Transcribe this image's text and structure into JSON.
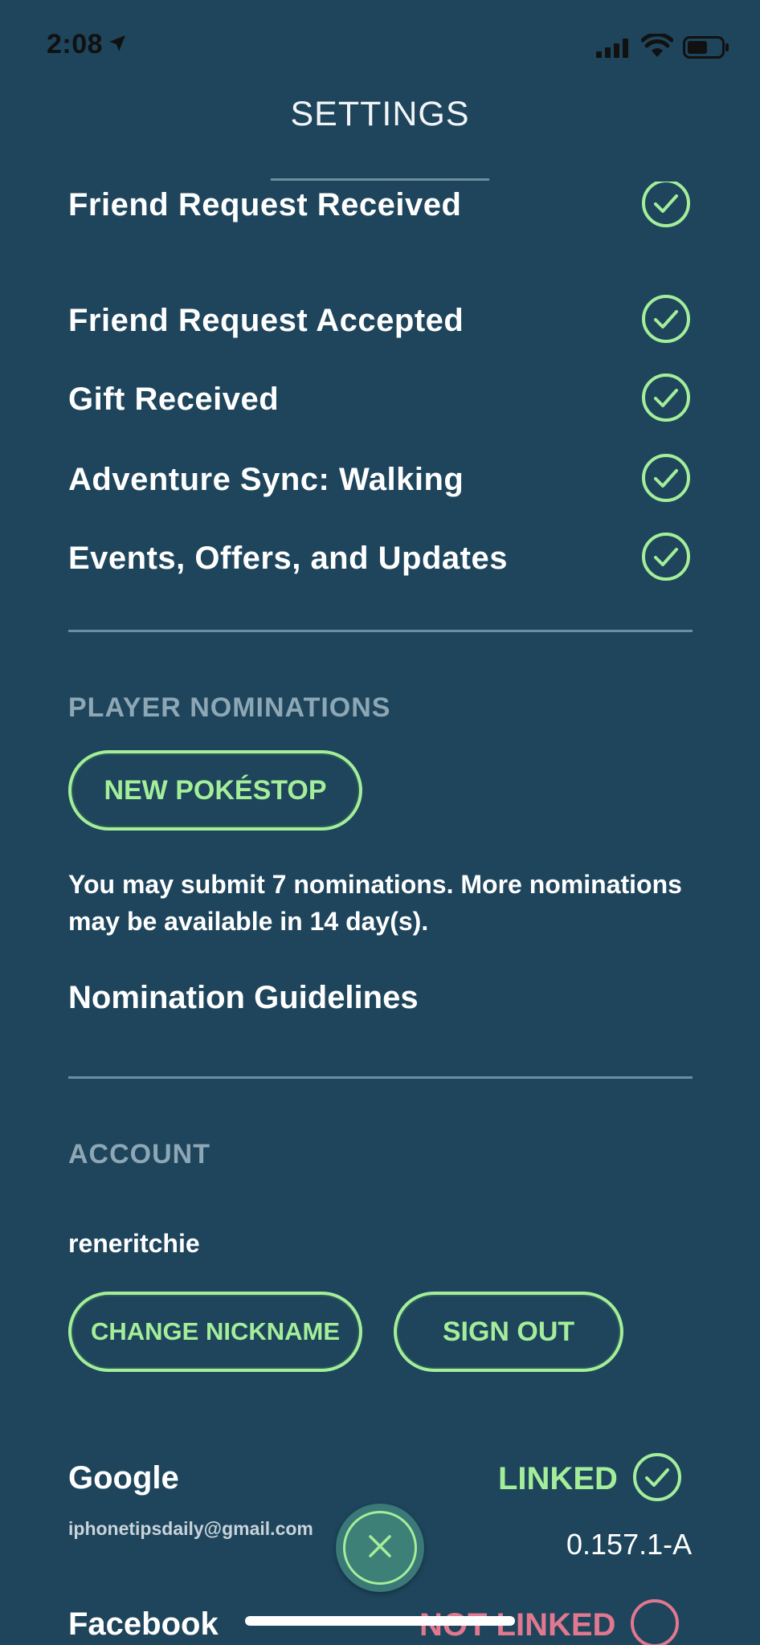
{
  "status_bar": {
    "time": "2:08",
    "location_icon": "location-arrow-icon",
    "signal_icon": "cellular-signal-icon",
    "wifi_icon": "wifi-icon",
    "battery_icon": "battery-icon"
  },
  "header": {
    "title": "SETTINGS"
  },
  "notifications": {
    "items": [
      {
        "label": "Friend Request Received",
        "checked": true
      },
      {
        "label": "Friend Request Accepted",
        "checked": true
      },
      {
        "label": "Gift Received",
        "checked": true
      },
      {
        "label": "Adventure Sync: Walking",
        "checked": true
      },
      {
        "label": "Events, Offers, and Updates",
        "checked": true
      }
    ]
  },
  "player_nominations": {
    "header": "PLAYER NOMINATIONS",
    "new_button": "NEW POKÉSTOP",
    "info": "You may submit 7 nominations. More nominations may be available in 14 day(s).",
    "guidelines_link": "Nomination Guidelines"
  },
  "account": {
    "header": "ACCOUNT",
    "nickname": "reneritchie",
    "change_nickname_button": "CHANGE NICKNAME",
    "sign_out_button": "SIGN OUT",
    "providers": [
      {
        "name": "Google",
        "status": "LINKED",
        "email": "iphonetipsdaily@gmail.com"
      },
      {
        "name": "Facebook",
        "status": "NOT LINKED"
      }
    ],
    "version": "0.157.1-A"
  },
  "colors": {
    "background": "#1e455c",
    "accent_green": "#a4ee9a",
    "accent_pink": "#e0788f",
    "section_header": "#8ea7b5",
    "divider": "#6d8ea0"
  }
}
